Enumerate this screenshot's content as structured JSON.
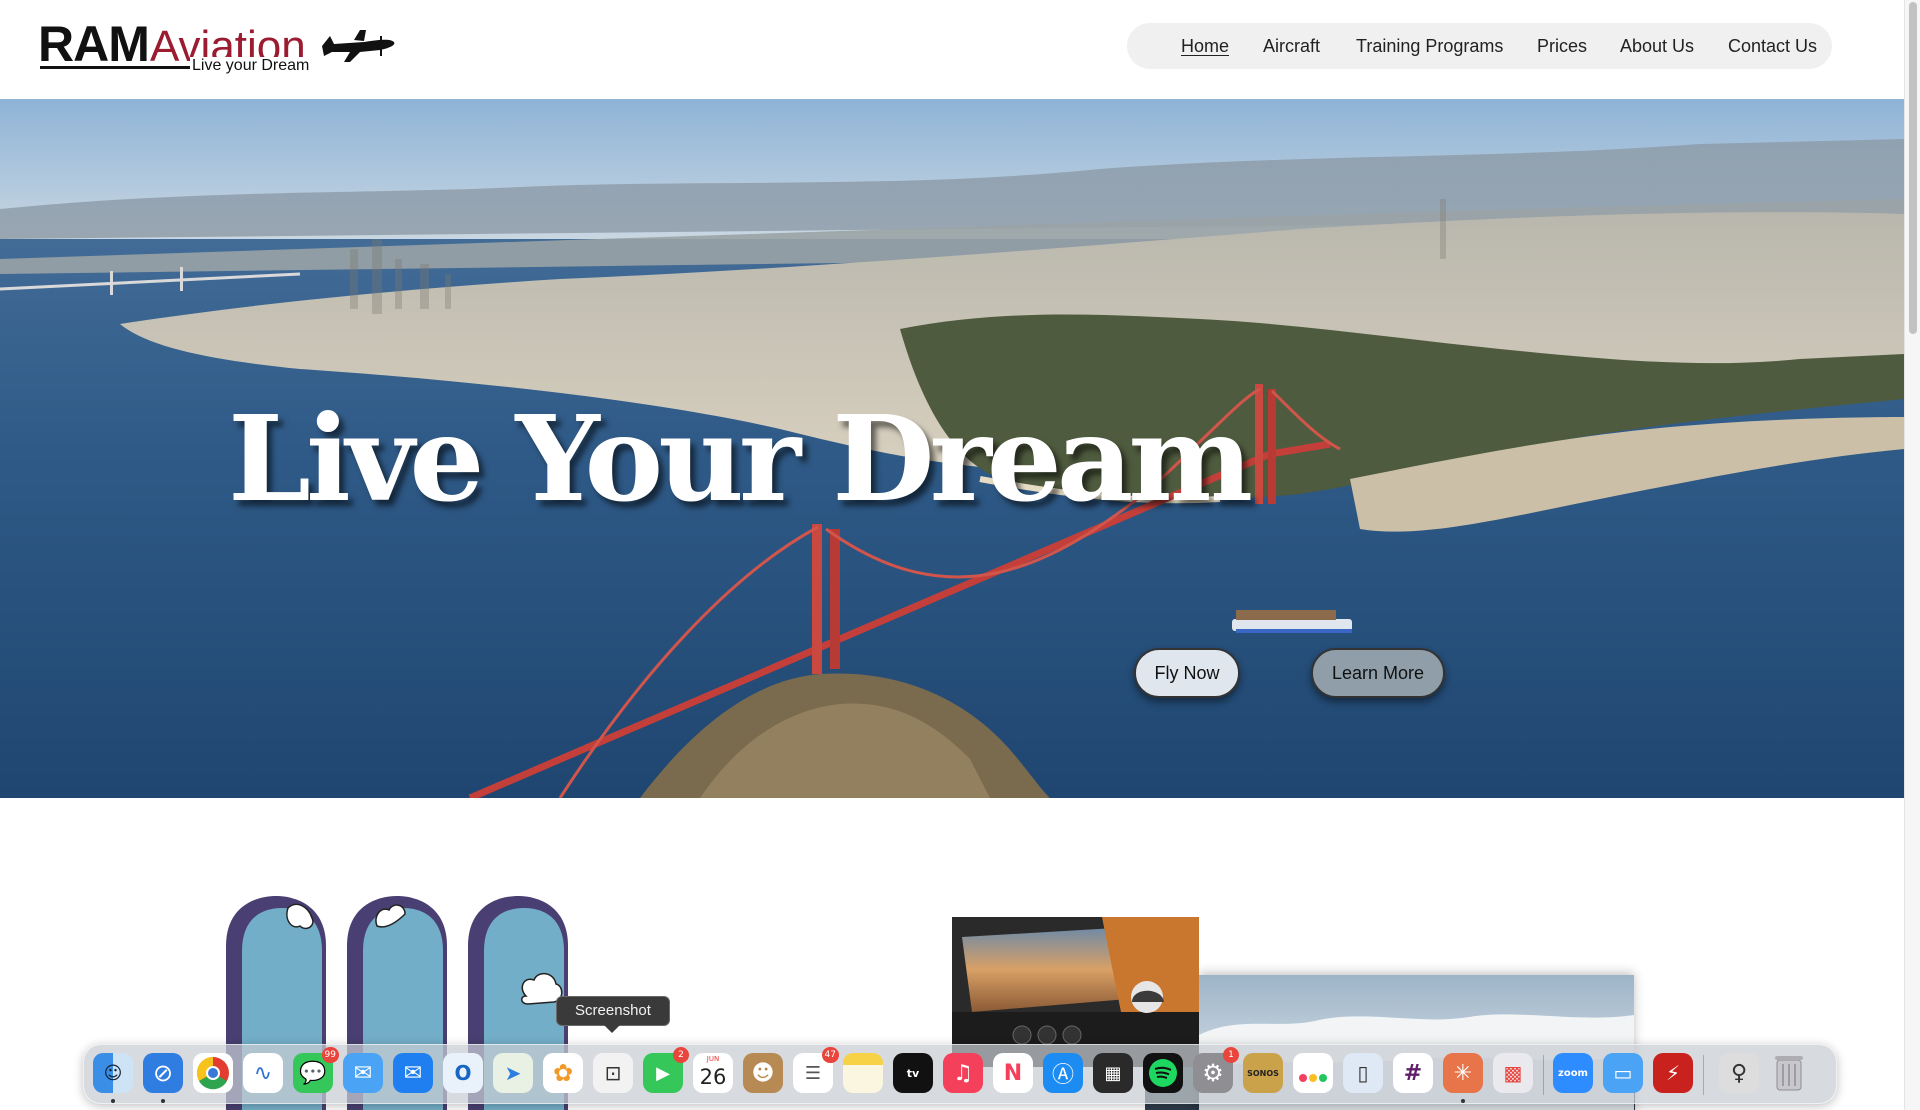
{
  "brand": {
    "name_part1": "RAM",
    "name_part2": "Aviation",
    "tagline": "Live your Dream",
    "primary_color": "#9b1b30"
  },
  "nav": {
    "items": [
      {
        "label": "Home",
        "active": true
      },
      {
        "label": "Aircraft"
      },
      {
        "label": "Training Programs"
      },
      {
        "label": "Prices"
      },
      {
        "label": "About Us"
      },
      {
        "label": "Contact Us"
      }
    ]
  },
  "hero": {
    "title": "Live Your Dream",
    "buttons": {
      "fly_now": "Fly Now",
      "learn_more": "Learn More"
    }
  },
  "dock": {
    "tooltip": "Screenshot",
    "items": [
      {
        "name": "finder-icon",
        "running": true
      },
      {
        "name": "safari-icon",
        "running": true
      },
      {
        "name": "chrome-icon"
      },
      {
        "name": "freeform-icon"
      },
      {
        "name": "messages-icon",
        "badge": "99"
      },
      {
        "name": "mail-icon"
      },
      {
        "name": "mail-blue-icon"
      },
      {
        "name": "outlook-icon"
      },
      {
        "name": "maps-icon"
      },
      {
        "name": "photos-icon"
      },
      {
        "name": "screenshot-icon"
      },
      {
        "name": "facetime-icon",
        "badge": "2"
      },
      {
        "name": "calendar-icon",
        "month": "JUN",
        "day": "26"
      },
      {
        "name": "contacts-icon"
      },
      {
        "name": "reminders-icon",
        "badge": "47"
      },
      {
        "name": "notes-icon"
      },
      {
        "name": "apple-tv-icon",
        "label": "tv"
      },
      {
        "name": "music-icon"
      },
      {
        "name": "news-icon"
      },
      {
        "name": "app-store-icon"
      },
      {
        "name": "calculator-icon"
      },
      {
        "name": "spotify-icon"
      },
      {
        "name": "system-settings-icon",
        "badge": "1"
      },
      {
        "name": "sonos-icon",
        "label": "SONOS"
      },
      {
        "name": "monday-icon"
      },
      {
        "name": "iphone-mirroring-icon"
      },
      {
        "name": "slack-icon"
      },
      {
        "name": "claude-icon",
        "running": true
      },
      {
        "name": "launchpad-icon"
      },
      {
        "name": "zoom-icon",
        "label": "zoom"
      },
      {
        "name": "files-icon"
      },
      {
        "name": "acrobat-icon"
      },
      {
        "name": "downloads-stack-icon"
      },
      {
        "name": "trash-icon"
      }
    ]
  }
}
